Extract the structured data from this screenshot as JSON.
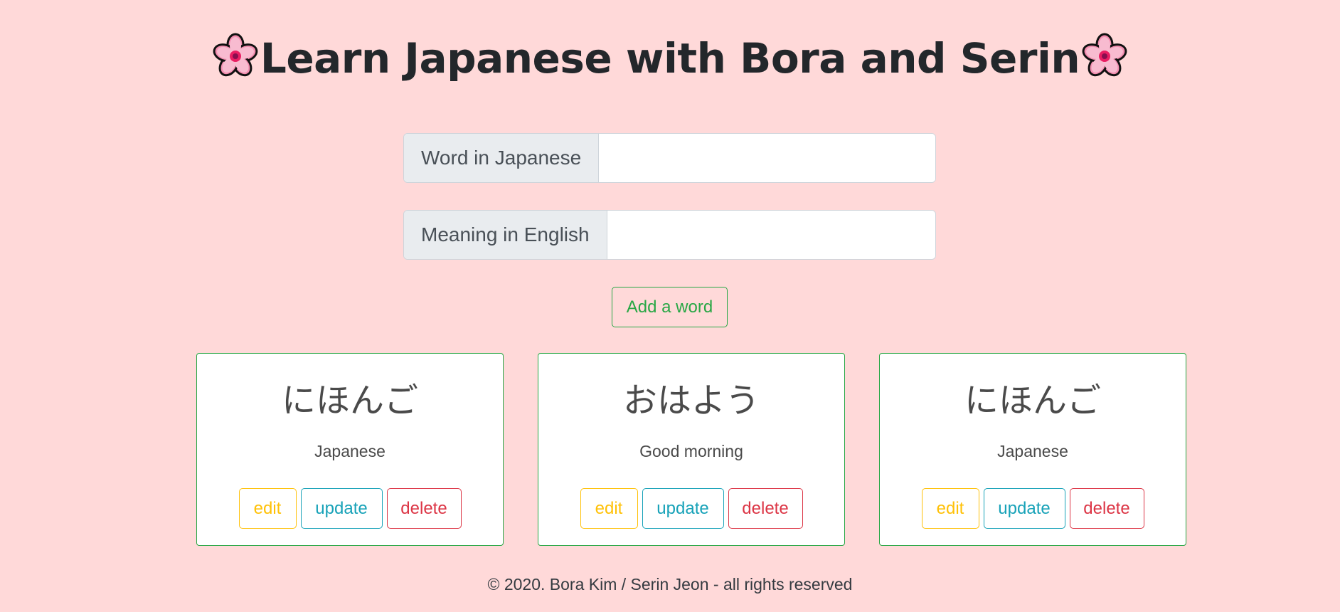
{
  "header": {
    "title": "Learn Japanese with Bora and Serin",
    "icon_left": "cherry-blossom-icon",
    "icon_right": "cherry-blossom-icon"
  },
  "form": {
    "japanese_label": "Word in Japanese",
    "japanese_value": "",
    "english_label": "Meaning in English",
    "english_value": "",
    "add_button_label": "Add a word"
  },
  "cards": [
    {
      "word": "にほんご",
      "meaning": "Japanese",
      "edit_label": "edit",
      "update_label": "update",
      "delete_label": "delete"
    },
    {
      "word": "おはよう",
      "meaning": "Good morning",
      "edit_label": "edit",
      "update_label": "update",
      "delete_label": "delete"
    },
    {
      "word": "にほんご",
      "meaning": "Japanese",
      "edit_label": "edit",
      "update_label": "update",
      "delete_label": "delete"
    }
  ],
  "footer": {
    "text": "© 2020. Bora Kim / Serin Jeon - all rights reserved"
  },
  "colors": {
    "background": "#ffd9d9",
    "success": "#28a745",
    "warning": "#ffc107",
    "info": "#17a2b8",
    "danger": "#dc3545"
  }
}
